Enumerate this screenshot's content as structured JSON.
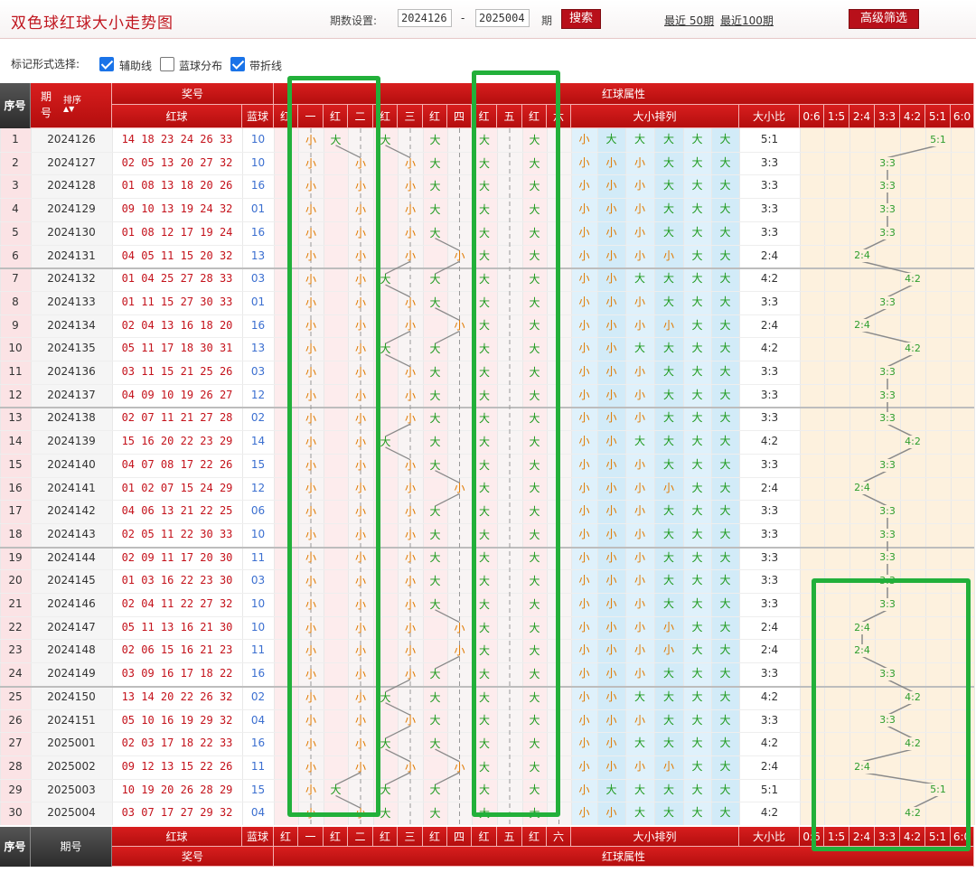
{
  "header": {
    "title": "双色球红球大小走势图",
    "period_label": "期数设置:",
    "period_from": "2024126",
    "period_dash": "-",
    "period_to": "2025004",
    "period_suffix": "期",
    "search_button": "搜索",
    "recent50": "最近 50期",
    "recent100": "最近100期",
    "advanced_button": "高级筛选"
  },
  "markbar": {
    "label": "标记形式选择:",
    "options": [
      {
        "label": "辅助线",
        "checked": true
      },
      {
        "label": "蓝球分布",
        "checked": false
      },
      {
        "label": "带折线",
        "checked": true
      }
    ]
  },
  "table_header": {
    "seq": "序号",
    "period": "期号",
    "sort": "排序",
    "prize": "奖号",
    "red": "红球",
    "blue": "蓝球",
    "attr": "红球属性",
    "positions": [
      "红",
      "一",
      "红",
      "二",
      "红",
      "三",
      "红",
      "四",
      "红",
      "五",
      "红",
      "六"
    ],
    "arrangement": "大小排列",
    "ratio": "大小比",
    "ratio_options": [
      "0:6",
      "1:5",
      "2:4",
      "3:3",
      "4:2",
      "5:1",
      "6:0"
    ]
  },
  "rows": [
    {
      "seq": "1",
      "period": "2024126",
      "red": "14 18 23 24 26 33",
      "blue": "10",
      "pos": [
        "小",
        "大",
        "大",
        "大",
        "大",
        "大"
      ],
      "ratio": "5:1"
    },
    {
      "seq": "2",
      "period": "2024127",
      "red": "02 05 13 20 27 32",
      "blue": "10",
      "pos": [
        "小",
        "小",
        "小",
        "大",
        "大",
        "大"
      ],
      "ratio": "3:3"
    },
    {
      "seq": "3",
      "period": "2024128",
      "red": "01 08 13 18 20 26",
      "blue": "16",
      "pos": [
        "小",
        "小",
        "小",
        "大",
        "大",
        "大"
      ],
      "ratio": "3:3"
    },
    {
      "seq": "4",
      "period": "2024129",
      "red": "09 10 13 19 24 32",
      "blue": "01",
      "pos": [
        "小",
        "小",
        "小",
        "大",
        "大",
        "大"
      ],
      "ratio": "3:3"
    },
    {
      "seq": "5",
      "period": "2024130",
      "red": "01 08 12 17 19 24",
      "blue": "16",
      "pos": [
        "小",
        "小",
        "小",
        "大",
        "大",
        "大"
      ],
      "ratio": "3:3"
    },
    {
      "seq": "6",
      "period": "2024131",
      "red": "04 05 11 15 20 32",
      "blue": "13",
      "pos": [
        "小",
        "小",
        "小",
        "小",
        "大",
        "大"
      ],
      "ratio": "2:4"
    },
    {
      "seq": "7",
      "period": "2024132",
      "red": "01 04 25 27 28 33",
      "blue": "03",
      "pos": [
        "小",
        "小",
        "大",
        "大",
        "大",
        "大"
      ],
      "ratio": "4:2"
    },
    {
      "seq": "8",
      "period": "2024133",
      "red": "01 11 15 27 30 33",
      "blue": "01",
      "pos": [
        "小",
        "小",
        "小",
        "大",
        "大",
        "大"
      ],
      "ratio": "3:3"
    },
    {
      "seq": "9",
      "period": "2024134",
      "red": "02 04 13 16 18 20",
      "blue": "16",
      "pos": [
        "小",
        "小",
        "小",
        "小",
        "大",
        "大"
      ],
      "ratio": "2:4"
    },
    {
      "seq": "10",
      "period": "2024135",
      "red": "05 11 17 18 30 31",
      "blue": "13",
      "pos": [
        "小",
        "小",
        "大",
        "大",
        "大",
        "大"
      ],
      "ratio": "4:2"
    },
    {
      "seq": "11",
      "period": "2024136",
      "red": "03 11 15 21 25 26",
      "blue": "03",
      "pos": [
        "小",
        "小",
        "小",
        "大",
        "大",
        "大"
      ],
      "ratio": "3:3"
    },
    {
      "seq": "12",
      "period": "2024137",
      "red": "04 09 10 19 26 27",
      "blue": "12",
      "pos": [
        "小",
        "小",
        "小",
        "大",
        "大",
        "大"
      ],
      "ratio": "3:3"
    },
    {
      "seq": "13",
      "period": "2024138",
      "red": "02 07 11 21 27 28",
      "blue": "02",
      "pos": [
        "小",
        "小",
        "小",
        "大",
        "大",
        "大"
      ],
      "ratio": "3:3"
    },
    {
      "seq": "14",
      "period": "2024139",
      "red": "15 16 20 22 23 29",
      "blue": "14",
      "pos": [
        "小",
        "小",
        "大",
        "大",
        "大",
        "大"
      ],
      "ratio": "4:2"
    },
    {
      "seq": "15",
      "period": "2024140",
      "red": "04 07 08 17 22 26",
      "blue": "15",
      "pos": [
        "小",
        "小",
        "小",
        "大",
        "大",
        "大"
      ],
      "ratio": "3:3"
    },
    {
      "seq": "16",
      "period": "2024141",
      "red": "01 02 07 15 24 29",
      "blue": "12",
      "pos": [
        "小",
        "小",
        "小",
        "小",
        "大",
        "大"
      ],
      "ratio": "2:4"
    },
    {
      "seq": "17",
      "period": "2024142",
      "red": "04 06 13 21 22 25",
      "blue": "06",
      "pos": [
        "小",
        "小",
        "小",
        "大",
        "大",
        "大"
      ],
      "ratio": "3:3"
    },
    {
      "seq": "18",
      "period": "2024143",
      "red": "02 05 11 22 30 33",
      "blue": "10",
      "pos": [
        "小",
        "小",
        "小",
        "大",
        "大",
        "大"
      ],
      "ratio": "3:3"
    },
    {
      "seq": "19",
      "period": "2024144",
      "red": "02 09 11 17 20 30",
      "blue": "11",
      "pos": [
        "小",
        "小",
        "小",
        "大",
        "大",
        "大"
      ],
      "ratio": "3:3"
    },
    {
      "seq": "20",
      "period": "2024145",
      "red": "01 03 16 22 23 30",
      "blue": "03",
      "pos": [
        "小",
        "小",
        "小",
        "大",
        "大",
        "大"
      ],
      "ratio": "3:3"
    },
    {
      "seq": "21",
      "period": "2024146",
      "red": "02 04 11 22 27 32",
      "blue": "10",
      "pos": [
        "小",
        "小",
        "小",
        "大",
        "大",
        "大"
      ],
      "ratio": "3:3"
    },
    {
      "seq": "22",
      "period": "2024147",
      "red": "05 11 13 16 21 30",
      "blue": "10",
      "pos": [
        "小",
        "小",
        "小",
        "小",
        "大",
        "大"
      ],
      "ratio": "2:4"
    },
    {
      "seq": "23",
      "period": "2024148",
      "red": "02 06 15 16 21 23",
      "blue": "11",
      "pos": [
        "小",
        "小",
        "小",
        "小",
        "大",
        "大"
      ],
      "ratio": "2:4"
    },
    {
      "seq": "24",
      "period": "2024149",
      "red": "03 09 16 17 18 22",
      "blue": "16",
      "pos": [
        "小",
        "小",
        "小",
        "大",
        "大",
        "大"
      ],
      "ratio": "3:3"
    },
    {
      "seq": "25",
      "period": "2024150",
      "red": "13 14 20 22 26 32",
      "blue": "02",
      "pos": [
        "小",
        "小",
        "大",
        "大",
        "大",
        "大"
      ],
      "ratio": "4:2"
    },
    {
      "seq": "26",
      "period": "2024151",
      "red": "05 10 16 19 29 32",
      "blue": "04",
      "pos": [
        "小",
        "小",
        "小",
        "大",
        "大",
        "大"
      ],
      "ratio": "3:3"
    },
    {
      "seq": "27",
      "period": "2025001",
      "red": "02 03 17 18 22 33",
      "blue": "16",
      "pos": [
        "小",
        "小",
        "大",
        "大",
        "大",
        "大"
      ],
      "ratio": "4:2"
    },
    {
      "seq": "28",
      "period": "2025002",
      "red": "09 12 13 15 22 26",
      "blue": "11",
      "pos": [
        "小",
        "小",
        "小",
        "小",
        "大",
        "大"
      ],
      "ratio": "2:4"
    },
    {
      "seq": "29",
      "period": "2025003",
      "red": "10 19 20 26 28 29",
      "blue": "15",
      "pos": [
        "小",
        "大",
        "大",
        "大",
        "大",
        "大"
      ],
      "ratio": "5:1"
    },
    {
      "seq": "30",
      "period": "2025004",
      "red": "03 07 17 27 29 32",
      "blue": "04",
      "pos": [
        "小",
        "小",
        "大",
        "大",
        "大",
        "大"
      ],
      "ratio": "4:2"
    }
  ],
  "colors": {
    "red_header": "#c4121b",
    "small": "#e07a00",
    "big": "#1d9a1d",
    "ratio_mark": "#2e9e2e",
    "highlight": "#22b03a",
    "blue_num": "#3b6fd0"
  }
}
